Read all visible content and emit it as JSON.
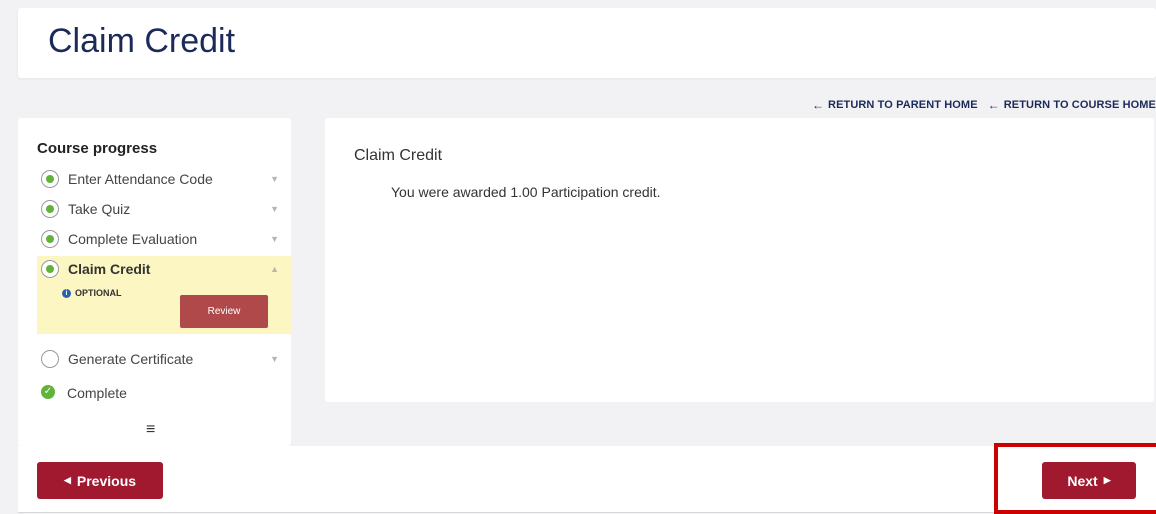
{
  "header": {
    "title": "Claim Credit"
  },
  "nav": {
    "parent_home": "RETURN TO PARENT HOME",
    "course_home": "RETURN TO COURSE HOME",
    "arrow": "←"
  },
  "sidebar": {
    "title": "Course progress",
    "steps": [
      {
        "label": "Enter Attendance Code",
        "status": "done"
      },
      {
        "label": "Take Quiz",
        "status": "done"
      },
      {
        "label": "Complete Evaluation",
        "status": "done"
      },
      {
        "label": "Claim Credit",
        "status": "active",
        "optional": "OPTIONAL",
        "review_label": "Review"
      },
      {
        "label": "Generate Certificate",
        "status": "pending"
      }
    ],
    "complete_label": "Complete",
    "menu_glyph": "≡"
  },
  "content": {
    "title": "Claim Credit",
    "message": "You were awarded 1.00 Participation credit."
  },
  "footer": {
    "previous_label": "Previous",
    "next_label": "Next"
  },
  "colors": {
    "primary": "#a0192f",
    "title": "#1c2a5a",
    "success": "#62b33a",
    "highlight": "#fcf6c2",
    "annotation": "#cc0000"
  }
}
